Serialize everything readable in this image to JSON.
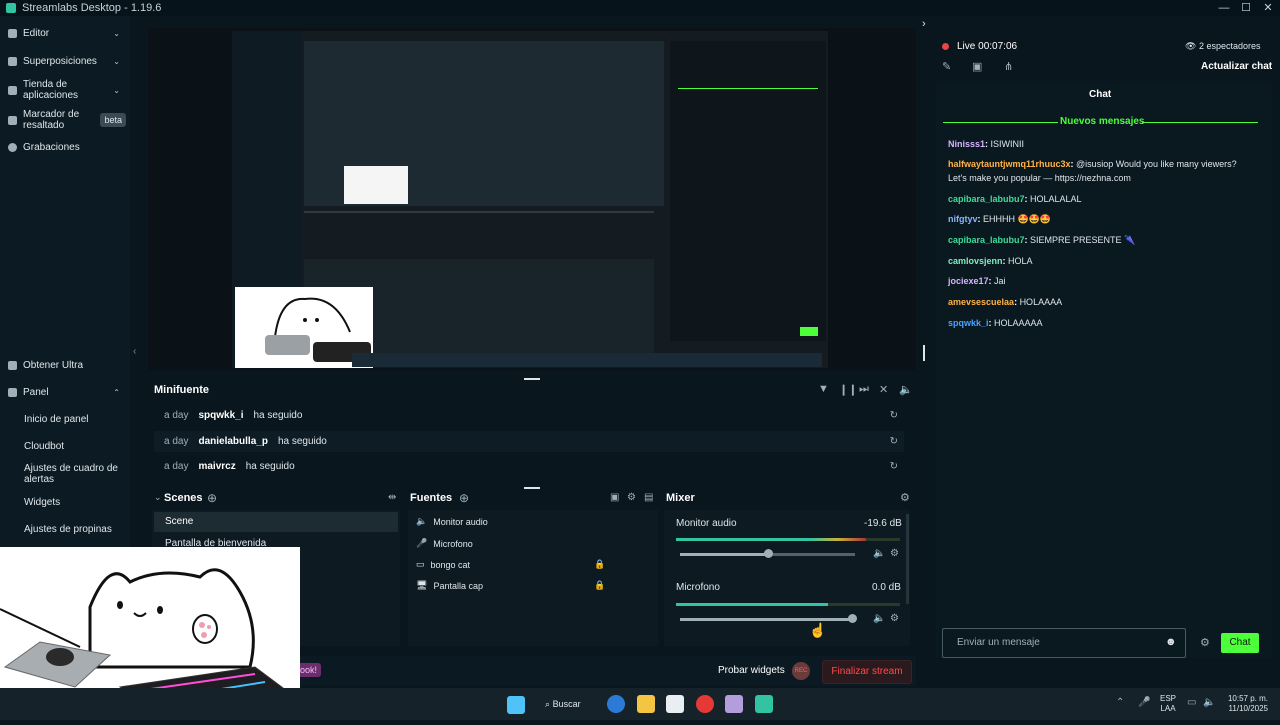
{
  "window": {
    "title": "Streamlabs Desktop - 1.19.6"
  },
  "sidebar": {
    "items": [
      {
        "label": "Editor"
      },
      {
        "label": "Superposiciones"
      },
      {
        "label": "Tienda de aplicaciones"
      },
      {
        "label": "Marcador de resaltado",
        "badge": "beta"
      },
      {
        "label": "Grabaciones"
      }
    ],
    "bottom_items": [
      {
        "label": "Obtener Ultra"
      },
      {
        "label": "Panel"
      }
    ],
    "panel_subitems": [
      {
        "label": "Inicio de panel"
      },
      {
        "label": "Cloudbot"
      },
      {
        "label": "Ajustes de cuadro de alertas"
      },
      {
        "label": "Widgets"
      },
      {
        "label": "Ajustes de propinas"
      }
    ]
  },
  "minifuente": {
    "title": "Minifuente",
    "rows": [
      {
        "time": "a day",
        "user": "spqwkk_i",
        "action": "ha seguido"
      },
      {
        "time": "a day",
        "user": "danielabulla_p",
        "action": "ha seguido"
      },
      {
        "time": "a day",
        "user": "maivrcz",
        "action": "ha seguido"
      }
    ]
  },
  "scenes": {
    "title": "Scenes",
    "items": [
      "Scene",
      "Pantalla de bienvenida"
    ]
  },
  "fuentes": {
    "title": "Fuentes",
    "items": [
      "Monitor audio",
      "Microfono",
      "bongo cat",
      "Pantalla cap"
    ]
  },
  "mixer": {
    "title": "Mixer",
    "channels": [
      {
        "name": "Monitor audio",
        "db": "-19.6 dB",
        "level": 0.5
      },
      {
        "name": "Microfono",
        "db": "0.0 dB",
        "level": 0.98
      }
    ]
  },
  "bottom_bar": {
    "probar_widgets": "Probar widgets",
    "rec": "REC",
    "finalizar": "Finalizar stream",
    "overlay_text": "ook!"
  },
  "live_header": {
    "status": "Live",
    "time": "00:07:06",
    "viewers": "2 espectadores",
    "refresh_chat": "Actualizar chat"
  },
  "chat": {
    "title": "Chat",
    "new_messages": "Nuevos mensajes",
    "messages": [
      {
        "user": "Ninisss1",
        "color": "#d7b3ff",
        "text": "ISIWINII"
      },
      {
        "user": "halfwaytauntjwmq11rhuuc3x",
        "color": "#ffb347",
        "text": "@isusiop Would you like many viewers? Let's make you popular — https://nezhna.com"
      },
      {
        "user": "capibara_labubu7",
        "color": "#3ddc97",
        "text": "HOLALALAL"
      },
      {
        "user": "nifgtyv",
        "color": "#8ab4ff",
        "text": "EHHHH 🤩🤩🤩"
      },
      {
        "user": "capibara_labubu7",
        "color": "#3ddc97",
        "text": "SIEMPRE PRESENTE 🌂"
      },
      {
        "user": "camlovsjenn",
        "color": "#7ef0c0",
        "text": "HOLA"
      },
      {
        "user": "jociexe17",
        "color": "#d7b3ff",
        "text": "Jai"
      },
      {
        "user": "amevsescuelaa",
        "color": "#ffb347",
        "text": "HOLAAAA"
      },
      {
        "user": "spqwkk_i",
        "color": "#4aa3ff",
        "text": "HOLAAAAA"
      }
    ],
    "input_placeholder": "Enviar un mensaje",
    "send_label": "Chat"
  },
  "taskbar": {
    "search_label": "Buscar",
    "lang_top": "ESP",
    "lang_bottom": "LAA",
    "time": "10:57 p. m.",
    "date": "11/10/2025"
  },
  "colors": {
    "accent_green": "#31c3a2",
    "chat_green": "#4cff3a",
    "live_red": "#e84545",
    "finalizar_red": "#ff4b4b"
  }
}
